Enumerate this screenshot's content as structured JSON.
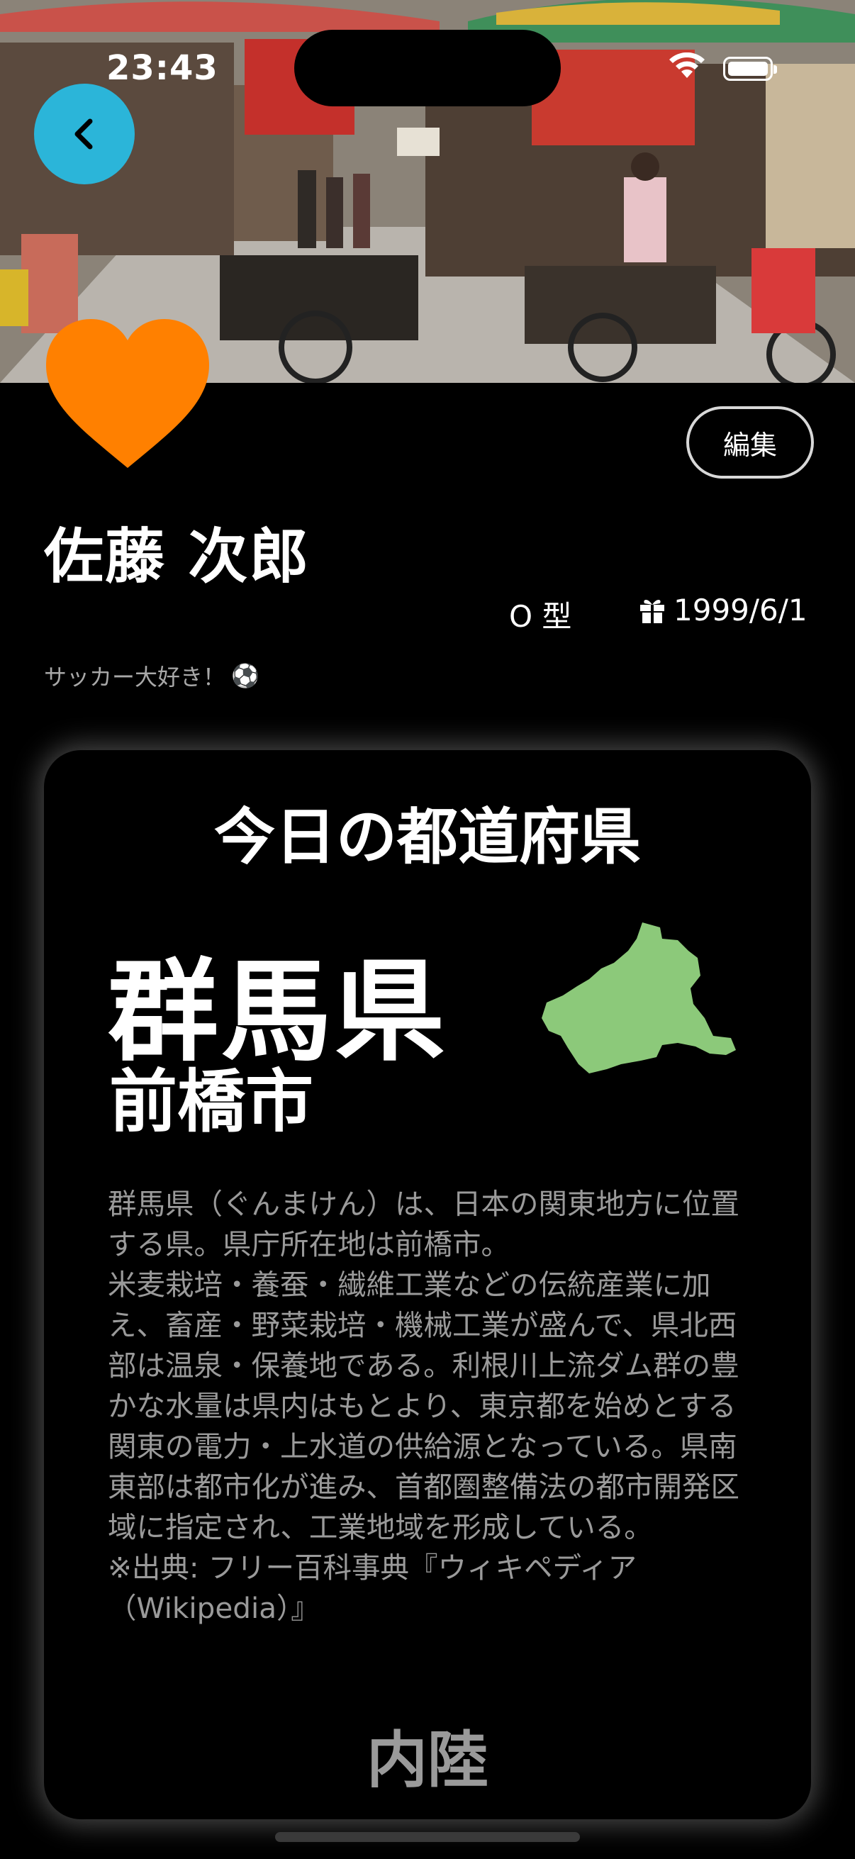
{
  "status_bar": {
    "time": "23:43"
  },
  "profile": {
    "name": "佐藤 次郎",
    "blood_type": "O 型",
    "birthday": "1999/6/1",
    "bio": "サッカー大好き！",
    "bio_emoji": "⚽",
    "edit_label": "編集",
    "avatar_icon": "heart-icon",
    "avatar_color": "#FF8000"
  },
  "card": {
    "title": "今日の都道府県",
    "prefecture": "群馬県",
    "capital": "前橋市",
    "map_color": "#8CC97A",
    "description": "群馬県（ぐんまけん）は、日本の関東地方に位置する県。県庁所在地は前橋市。\n米麦栽培・養蚕・繊維工業などの伝統産業に加え、畜産・野菜栽培・機械工業が盛んで、県北西部は温泉・保養地である。利根川上流ダム群の豊かな水量は県内はもとより、東京都を始めとする関東の電力・上水道の供給源となっている。県南東部は都市化が進み、首都圏整備法の都市開発区域に指定され、工業地域を形成している。\n※出典: フリー百科事典『ウィキペディア（Wikipedia）』",
    "region": "内陸"
  },
  "colors": {
    "back_button": "#2BB5D9",
    "background": "#000000"
  }
}
